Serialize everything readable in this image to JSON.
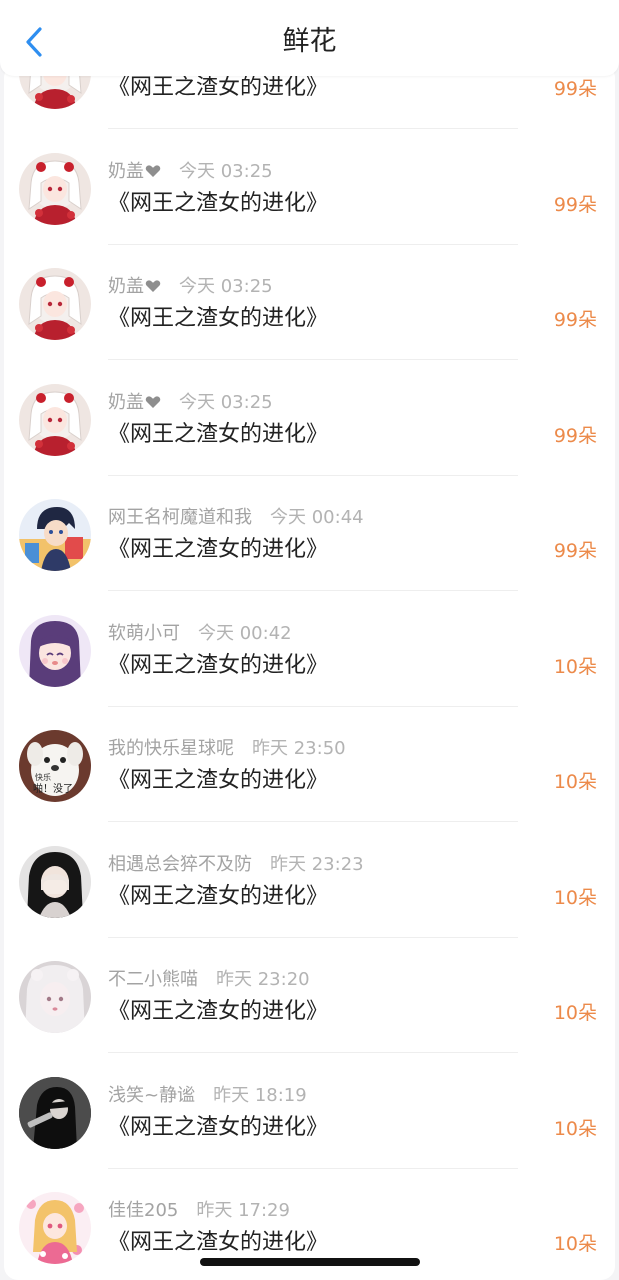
{
  "header": {
    "title": "鲜花"
  },
  "rows": [
    {
      "name": "",
      "time": "",
      "book": "《网王之渣女的进化》",
      "count": "99朵",
      "avatar": "red-dress-girl",
      "heart": false
    },
    {
      "name": "奶盖",
      "time": "今天 03:25",
      "book": "《网王之渣女的进化》",
      "count": "99朵",
      "avatar": "red-dress-girl",
      "heart": true
    },
    {
      "name": "奶盖",
      "time": "今天 03:25",
      "book": "《网王之渣女的进化》",
      "count": "99朵",
      "avatar": "red-dress-girl",
      "heart": true
    },
    {
      "name": "奶盖",
      "time": "今天 03:25",
      "book": "《网王之渣女的进化》",
      "count": "99朵",
      "avatar": "red-dress-girl",
      "heart": true
    },
    {
      "name": "网王名柯魔道和我",
      "time": "今天 00:44",
      "book": "《网王之渣女的进化》",
      "count": "99朵",
      "avatar": "anime-boy",
      "heart": false
    },
    {
      "name": "软萌小可",
      "time": "今天 00:42",
      "book": "《网王之渣女的进化》",
      "count": "10朵",
      "avatar": "purple-hair-girl",
      "heart": false
    },
    {
      "name": "我的快乐星球呢",
      "time": "昨天 23:50",
      "book": "《网王之渣女的进化》",
      "count": "10朵",
      "avatar": "white-dog",
      "heart": false
    },
    {
      "name": "相遇总会猝不及防",
      "time": "昨天 23:23",
      "book": "《网王之渣女的进化》",
      "count": "10朵",
      "avatar": "dark-hair-girl",
      "heart": false
    },
    {
      "name": "不二小熊喵",
      "time": "昨天 23:20",
      "book": "《网王之渣女的进化》",
      "count": "10朵",
      "avatar": "pale-girl",
      "heart": false
    },
    {
      "name": "浅笑~静谧",
      "time": "昨天 18:19",
      "book": "《网王之渣女的进化》",
      "count": "10朵",
      "avatar": "dark-figure",
      "heart": false
    },
    {
      "name": "佳佳205",
      "time": "昨天 17:29",
      "book": "《网王之渣女的进化》",
      "count": "10朵",
      "avatar": "pink-anime-girl",
      "heart": false
    }
  ],
  "dog_text": {
    "line1": "快乐",
    "line2": "啪！没了"
  },
  "colors": {
    "accent_orange": "#ec8a4a",
    "back_blue": "#2e8ef0",
    "name_gray": "#a3a3a3"
  }
}
